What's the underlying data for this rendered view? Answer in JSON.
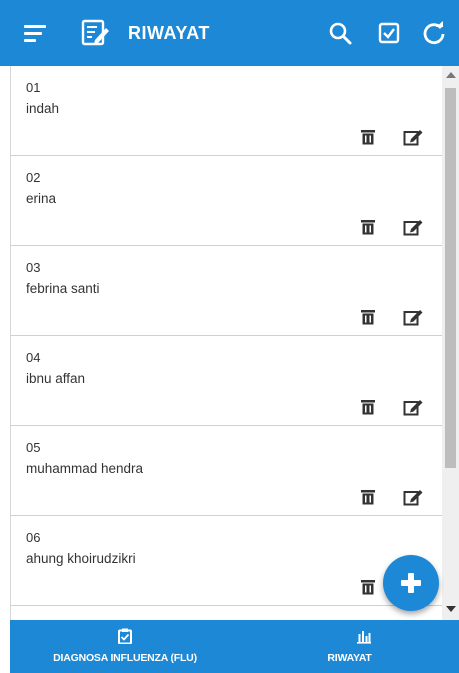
{
  "app": {
    "title": "RIWAYAT",
    "brand_color": "#1c88d6"
  },
  "toolbar": {
    "icons": [
      "menu-icon",
      "notes-edit-icon",
      "search-icon",
      "check-square-icon",
      "refresh-icon"
    ]
  },
  "list": {
    "items": [
      {
        "number": "01",
        "name": "indah"
      },
      {
        "number": "02",
        "name": "erina"
      },
      {
        "number": "03",
        "name": "febrina santi"
      },
      {
        "number": "04",
        "name": "ibnu affan"
      },
      {
        "number": "05",
        "name": "muhammad hendra"
      },
      {
        "number": "06",
        "name": "ahung khoirudzikri"
      }
    ],
    "row_icons": [
      "trash-icon",
      "edit-icon"
    ]
  },
  "fab": {
    "icon": "plus-icon"
  },
  "bottom_nav": {
    "tabs": [
      {
        "label": "DIAGNOSA INFLUENZA (FLU)",
        "icon": "clipboard-check-icon"
      },
      {
        "label": "RIWAYAT",
        "icon": "bar-chart-icon"
      }
    ]
  }
}
